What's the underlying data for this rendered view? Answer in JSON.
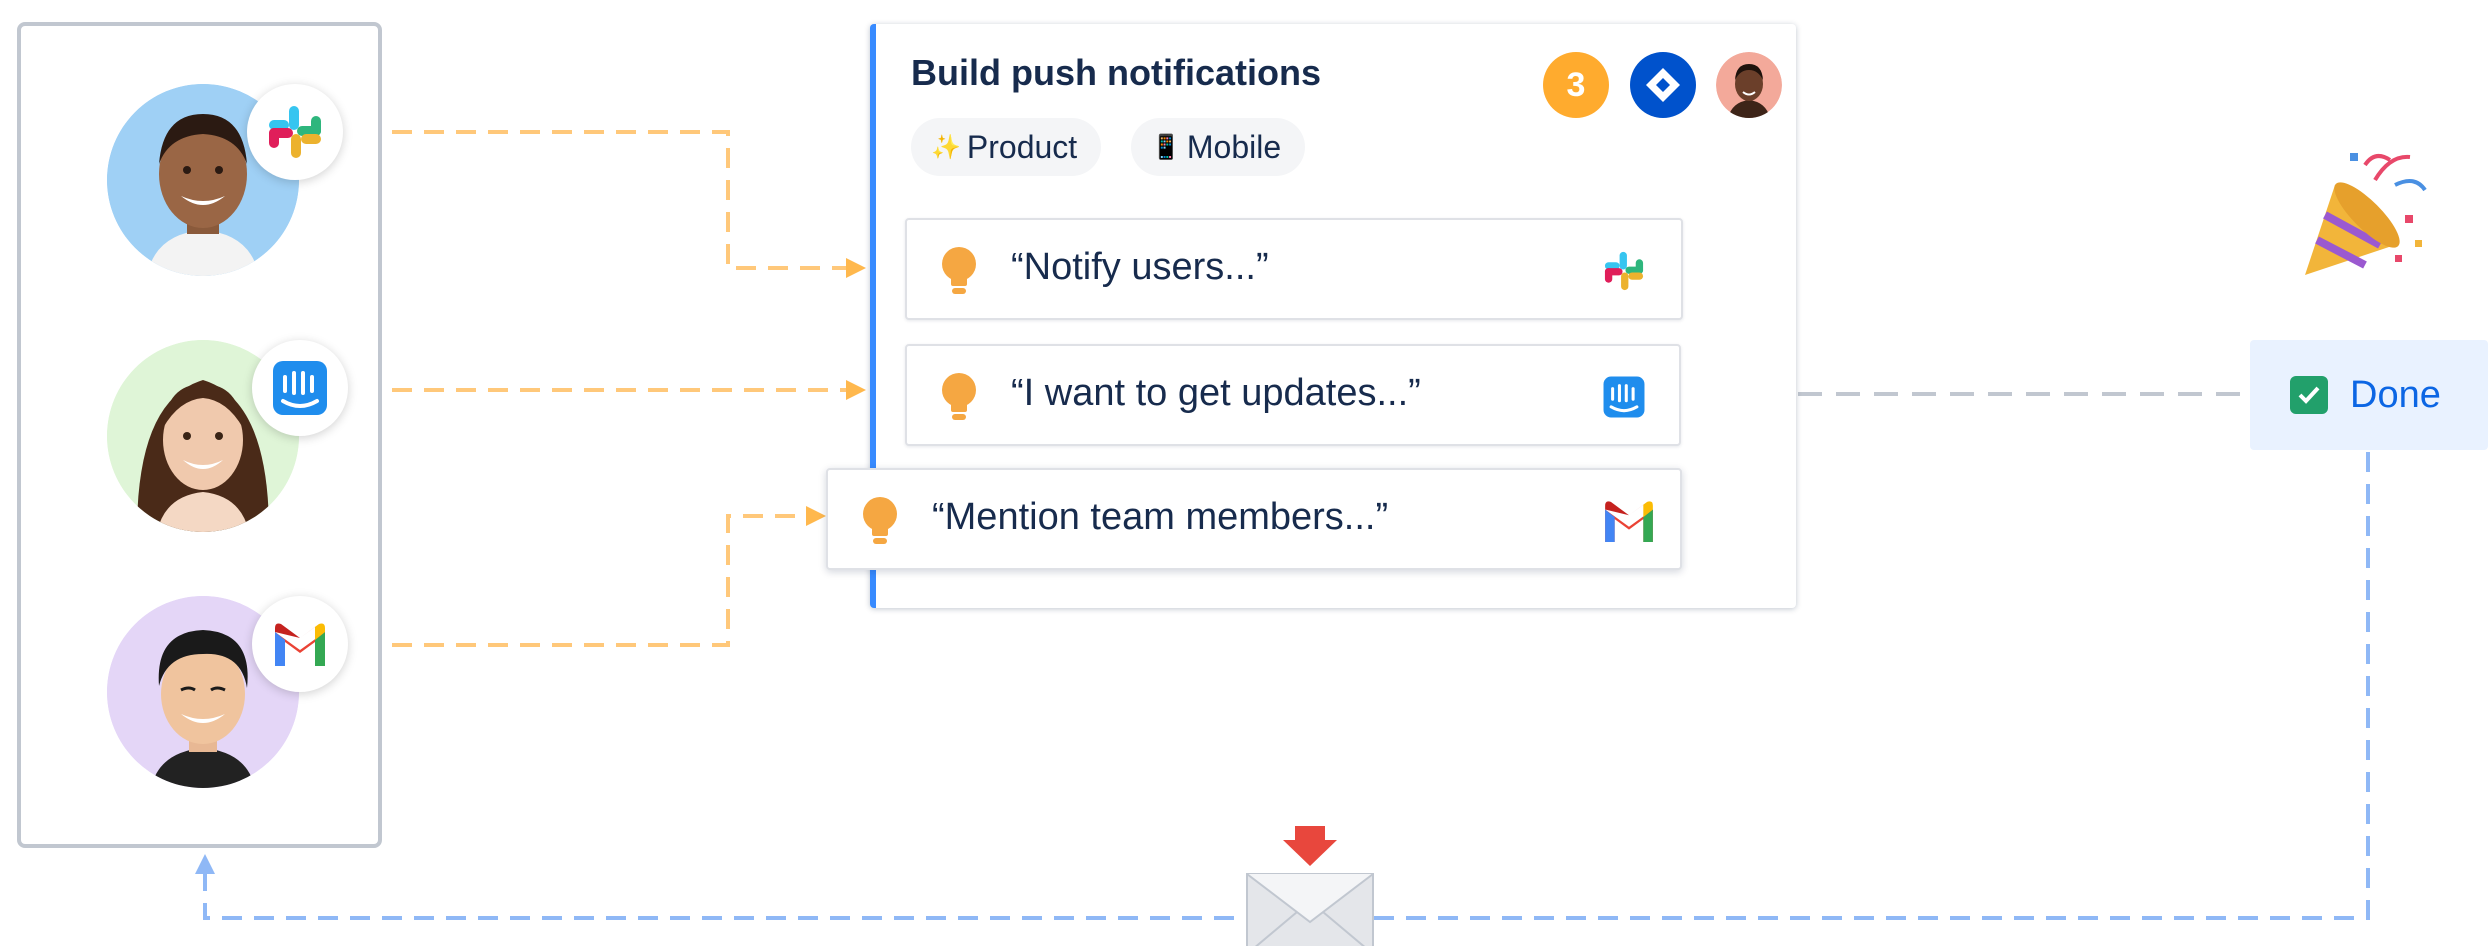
{
  "users": [
    {
      "name": "user-1",
      "app_icon": "slack-icon",
      "bg": "#9fd0f5"
    },
    {
      "name": "user-2",
      "app_icon": "intercom-icon",
      "bg": "#dff5d7"
    },
    {
      "name": "user-3",
      "app_icon": "gmail-icon",
      "bg": "#e4d6f7"
    }
  ],
  "card": {
    "title": "Build push notifications",
    "count": "3",
    "tags": [
      {
        "emoji": "✨",
        "label": "Product"
      },
      {
        "emoji": "📱",
        "label": "Mobile"
      }
    ],
    "insights": [
      {
        "text": "“Notify users...”",
        "source_icon": "slack-icon"
      },
      {
        "text": "“I want to get updates...”",
        "source_icon": "intercom-icon"
      },
      {
        "text": "“Mention team members...”",
        "source_icon": "gmail-icon"
      }
    ]
  },
  "status": {
    "label": "Done",
    "icon": "check-icon"
  },
  "celebration_icon": "party-popper-icon",
  "notify_icon": "envelope-icon",
  "colors": {
    "orange_connector": "#ffc87a",
    "gray_connector": "#c1c7d0",
    "blue_connector": "#8fb8f6",
    "accent_blue": "#388bff",
    "count_badge": "#ffab2e",
    "done_text": "#0c66e4"
  }
}
